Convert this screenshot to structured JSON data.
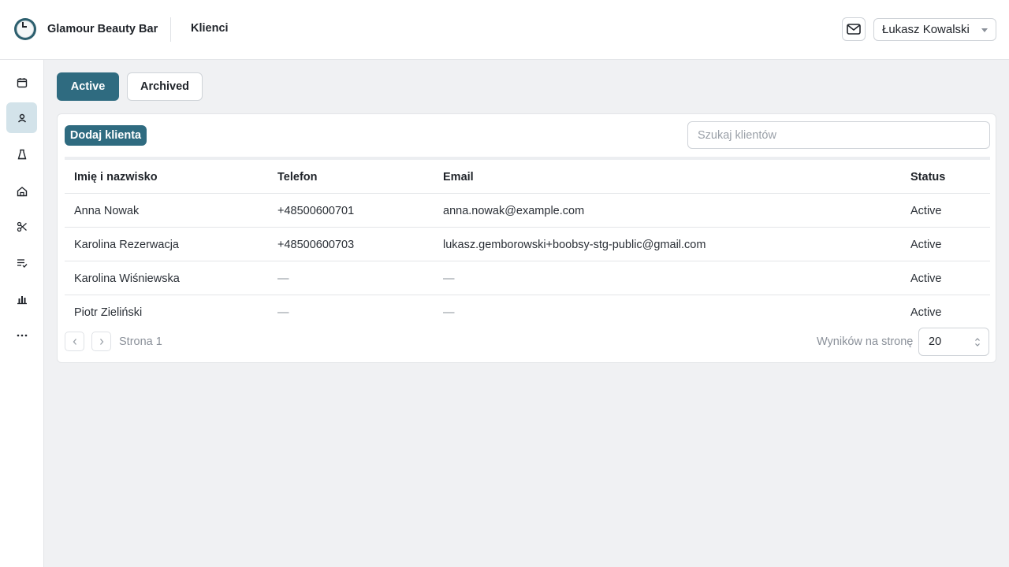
{
  "header": {
    "brand": "Glamour Beauty Bar",
    "page_title": "Klienci",
    "user_name": "Łukasz Kowalski"
  },
  "sidebar": {
    "items": [
      {
        "icon": "calendar-icon",
        "active": false
      },
      {
        "icon": "clients-icon",
        "active": true
      },
      {
        "icon": "products-icon",
        "active": false
      },
      {
        "icon": "home-icon",
        "active": false
      },
      {
        "icon": "scissors-icon",
        "active": false
      },
      {
        "icon": "checklist-icon",
        "active": false
      },
      {
        "icon": "bar-chart-icon",
        "active": false
      },
      {
        "icon": "more-icon",
        "active": false
      }
    ]
  },
  "tabs": {
    "active_label": "Active",
    "archived_label": "Archived",
    "selected": "Active"
  },
  "toolbar": {
    "add_label": "Dodaj klienta",
    "search_placeholder": "Szukaj klientów",
    "search_value": ""
  },
  "table": {
    "headers": [
      "Imię i nazwisko",
      "Telefon",
      "Email",
      "Status"
    ],
    "rows": [
      [
        "Anna Nowak",
        "+48500600701",
        "anna.nowak@example.com",
        "Active"
      ],
      [
        "Karolina Rezerwacja",
        "+48500600703",
        "lukasz.gemborowski+boobsy-stg-public@gmail.com",
        "Active"
      ],
      [
        "Karolina Wiśniewska",
        "—",
        "—",
        "Active"
      ],
      [
        "Piotr Zieliński",
        "—",
        "—",
        "Active"
      ]
    ]
  },
  "pagination": {
    "page_label": "Strona 1",
    "per_page_label": "Wyników na stronę",
    "per_page_value": "20"
  },
  "colors": {
    "accent": "#2f6b80",
    "active_nav_bg": "#d3e3ea",
    "page_bg": "#f0f1f3"
  }
}
